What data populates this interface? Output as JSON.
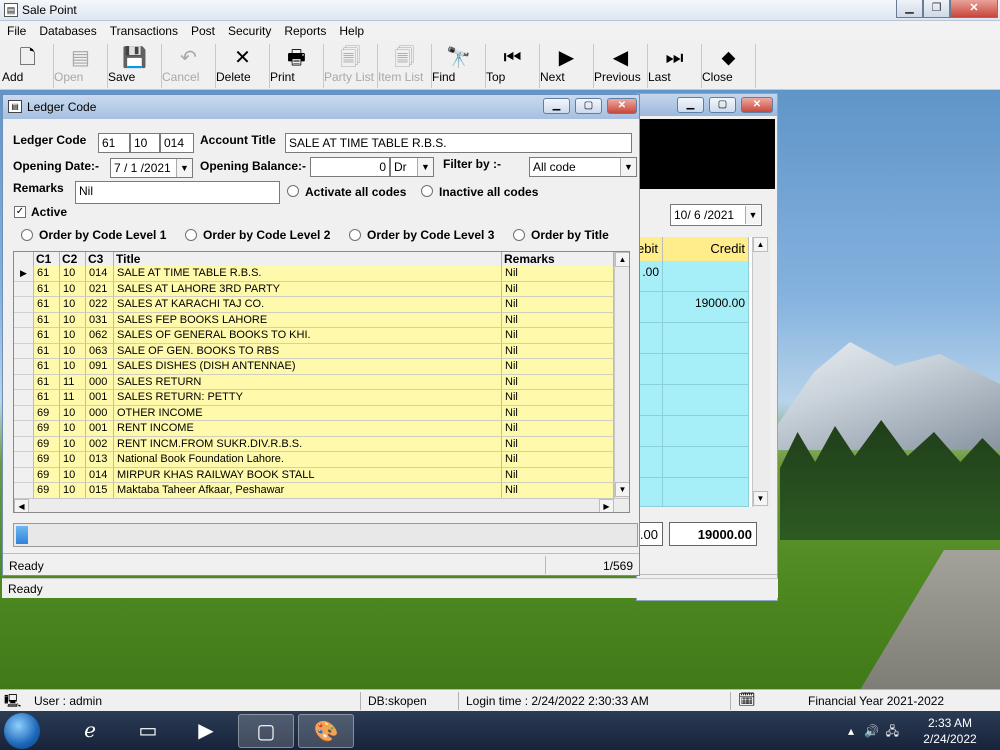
{
  "app": {
    "title": "Sale Point"
  },
  "menu": [
    "File",
    "Databases",
    "Transactions",
    "Post",
    "Security",
    "Reports",
    "Help"
  ],
  "toolbar": [
    {
      "label": "Add",
      "icon": "new-document-icon",
      "glyph": "🗋",
      "enabled": true
    },
    {
      "label": "Open",
      "icon": "open-folder-icon",
      "glyph": "▤",
      "enabled": false
    },
    {
      "label": "Save",
      "icon": "save-disk-icon",
      "glyph": "💾",
      "enabled": true
    },
    {
      "label": "Cancel",
      "icon": "undo-icon",
      "glyph": "↶",
      "enabled": false
    },
    {
      "label": "Delete",
      "icon": "delete-x-icon",
      "glyph": "✕",
      "enabled": true
    },
    {
      "label": "Print",
      "icon": "printer-icon",
      "glyph": "🖶",
      "enabled": true
    },
    {
      "label": "Party List",
      "icon": "party-list-icon",
      "glyph": "🗐",
      "enabled": false
    },
    {
      "label": "Item List",
      "icon": "item-list-icon",
      "glyph": "🗐",
      "enabled": false
    },
    {
      "label": "Find",
      "icon": "binoculars-icon",
      "glyph": "🔭",
      "enabled": true
    },
    {
      "label": "Top",
      "icon": "first-record-icon",
      "glyph": "⏮",
      "enabled": true
    },
    {
      "label": "Next",
      "icon": "next-record-icon",
      "glyph": "▶",
      "enabled": true
    },
    {
      "label": "Previous",
      "icon": "previous-record-icon",
      "glyph": "◀",
      "enabled": true
    },
    {
      "label": "Last",
      "icon": "last-record-icon",
      "glyph": "⏭",
      "enabled": true
    },
    {
      "label": "Close",
      "icon": "close-arrow-icon",
      "glyph": "⬥",
      "enabled": true
    }
  ],
  "ledger": {
    "title": "Ledger Code",
    "ledger_code_label": "Ledger Code",
    "code": [
      "61",
      "10",
      "014"
    ],
    "account_title_label": "Account Title",
    "account_title": "SALE AT TIME TABLE R.B.S.",
    "opening_date_label": "Opening Date:-",
    "opening_date": "7 / 1 /2021",
    "opening_balance_label": "Opening Balance:-",
    "opening_balance": "0",
    "dr_cr": "Dr",
    "filter_label": "Filter by  :-",
    "filter_value": "All code",
    "remarks_label": "Remarks",
    "remarks_value": "Nil",
    "activate_all": "Activate all codes",
    "inactive_all": "Inactive all codes",
    "active_label": "Active",
    "active_checked": true,
    "order_options": [
      "Order by Code Level 1",
      "Order by Code Level 2",
      "Order by Code Level 3",
      "Order by Title"
    ],
    "grid_headers": [
      "C1",
      "C2",
      "C3",
      "Title",
      "Remarks"
    ],
    "rows": [
      [
        "61",
        "10",
        "014",
        "SALE AT TIME TABLE R.B.S.",
        "Nil"
      ],
      [
        "61",
        "10",
        "021",
        "SALES AT LAHORE 3RD PARTY",
        "Nil"
      ],
      [
        "61",
        "10",
        "022",
        "SALES AT KARACHI TAJ CO.",
        "Nil"
      ],
      [
        "61",
        "10",
        "031",
        "SALES FEP BOOKS LAHORE",
        "Nil"
      ],
      [
        "61",
        "10",
        "062",
        "SALES OF GENERAL BOOKS TO KHI.",
        "Nil"
      ],
      [
        "61",
        "10",
        "063",
        "SALE OF GEN. BOOKS TO RBS",
        "Nil"
      ],
      [
        "61",
        "10",
        "091",
        "SALES DISHES (DISH ANTENNAE)",
        "Nil"
      ],
      [
        "61",
        "11",
        "000",
        "SALES RETURN",
        "Nil"
      ],
      [
        "61",
        "11",
        "001",
        "SALES RETURN: PETTY",
        "Nil"
      ],
      [
        "69",
        "10",
        "000",
        "OTHER INCOME",
        "Nil"
      ],
      [
        "69",
        "10",
        "001",
        "RENT INCOME",
        "Nil"
      ],
      [
        "69",
        "10",
        "002",
        "RENT INCM.FROM SUKR.DIV.R.B.S.",
        "Nil"
      ],
      [
        "69",
        "10",
        "013",
        "National Book Foundation Lahore.",
        "Nil"
      ],
      [
        "69",
        "10",
        "014",
        "MIRPUR KHAS RAILWAY BOOK STALL",
        "Nil"
      ],
      [
        "69",
        "10",
        "015",
        "Maktaba Taheer Afkaar, Peshawar",
        "Nil"
      ]
    ],
    "progress_fraction": 0.02,
    "status_text": "Ready",
    "record_count": "1/569"
  },
  "journal": {
    "date": "10/ 6 /2021",
    "debit_header": "ebit",
    "credit_header": "Credit",
    "first_debit": ".00",
    "first_credit": "19000.00",
    "debit_total": ".00",
    "credit_total": "19000.00"
  },
  "main_status": "Ready",
  "app_status": {
    "user": "User : admin",
    "db": "DB:skopen",
    "login": "Login time : 2/24/2022 2:30:33 AM",
    "financial_year": "Financial Year 2021-2022"
  },
  "taskbar": {
    "time": "2:33 AM",
    "date": "2/24/2022"
  }
}
